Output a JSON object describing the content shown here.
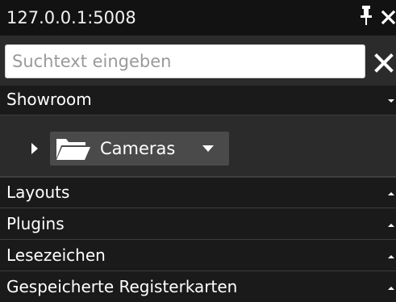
{
  "window": {
    "title": "127.0.0.1:5008"
  },
  "search": {
    "placeholder": "Suchtext eingeben",
    "value": ""
  },
  "sections": {
    "showroom": "Showroom",
    "layouts": "Layouts",
    "plugins": "Plugins",
    "bookmarks": "Lesezeichen",
    "saved_tabs": "Gespeicherte Registerkarten"
  },
  "tree": {
    "node_label": "Cameras"
  },
  "icons": {
    "pin": "pin-icon",
    "close": "close-icon",
    "clear": "clear-search-icon",
    "folder": "folder-icon",
    "expand": "triangle-right-icon",
    "dropdown": "triangle-down-icon",
    "collapse": "triangle-up-icon"
  },
  "colors": {
    "titlebar_bg": "#121212",
    "panel_bg": "#2b2b2b",
    "section_bg": "#1a1a1a",
    "selected_node_bg": "#4a4a4a",
    "text": "#ffffff",
    "placeholder": "#9a9a9a"
  }
}
